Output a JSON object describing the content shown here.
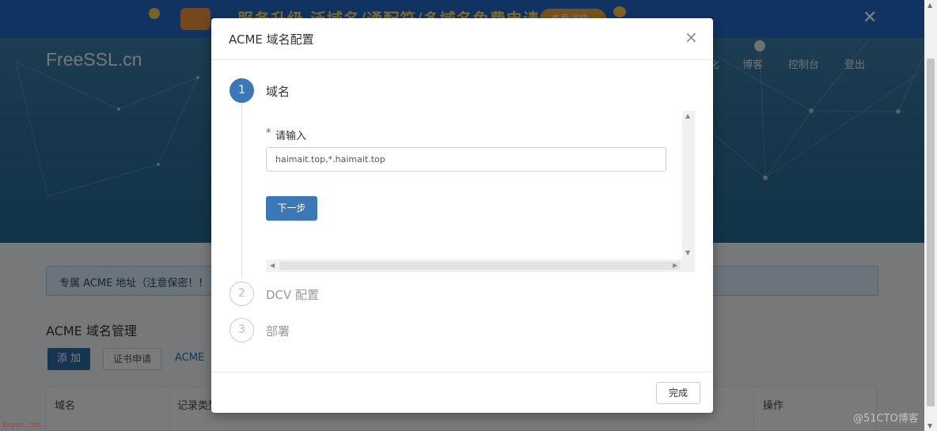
{
  "banner": {
    "promo_text": "服务升级 泛域名/通配符/多域名免费申请",
    "promo_button": "查看详情 ›",
    "close": "✕",
    "colors": {
      "background": "#2266c4",
      "text": "#ffd76a",
      "button": "#f3a63a"
    }
  },
  "site": {
    "logo": "FreeSSL.cn",
    "nav": [
      {
        "label": "化"
      },
      {
        "label": "博客"
      },
      {
        "label": "控制台"
      },
      {
        "label": "登出"
      }
    ]
  },
  "main": {
    "alert_text": "专属 ACME 地址（注意保密！！",
    "section_title": "ACME 域名管理",
    "buttons": {
      "add": "添 加",
      "cert_apply": "证书申请",
      "acme_link": "ACME"
    },
    "table_headers": [
      "域名",
      "记录类型",
      "操作"
    ]
  },
  "modal": {
    "title": "ACME 域名配置",
    "close": "×",
    "steps": [
      {
        "number": "1",
        "title": "域名",
        "status": "active"
      },
      {
        "number": "2",
        "title": "DCV 配置",
        "status": "pending"
      },
      {
        "number": "3",
        "title": "部署",
        "status": "pending"
      }
    ],
    "form": {
      "required_mark": "*",
      "label": "请输入",
      "input_value": "haimait.top,*.haimait.top",
      "next_button": "下一步"
    },
    "footer_button": "完成",
    "colors": {
      "primary": "#3b78b5"
    }
  },
  "watermarks": {
    "left": "kkpan.com",
    "right": "@51CTO博客"
  }
}
